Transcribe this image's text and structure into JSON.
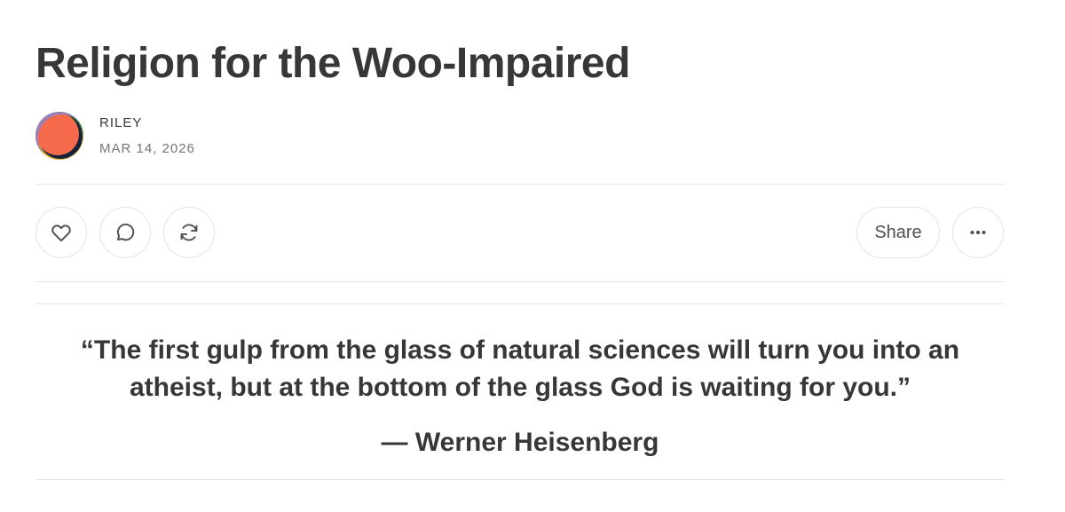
{
  "post": {
    "title": "Religion for the Woo-Impaired",
    "author": "RILEY",
    "date": "MAR 14, 2026"
  },
  "actions": {
    "like_icon": "heart-icon",
    "comment_icon": "comment-icon",
    "restack_icon": "restack-icon",
    "share_label": "Share",
    "more_icon": "more-icon"
  },
  "body": {
    "quote_lines": [
      "“The first gulp from the glass of natural sciences will turn you into an",
      "atheist, but at the bottom of the glass God is waiting for you.”"
    ],
    "attribution": "— Werner Heisenberg"
  },
  "colors": {
    "text": "#363737",
    "muted": "#757575",
    "divider": "#e5e5e5",
    "avatar_orange": "#f46a4a"
  }
}
